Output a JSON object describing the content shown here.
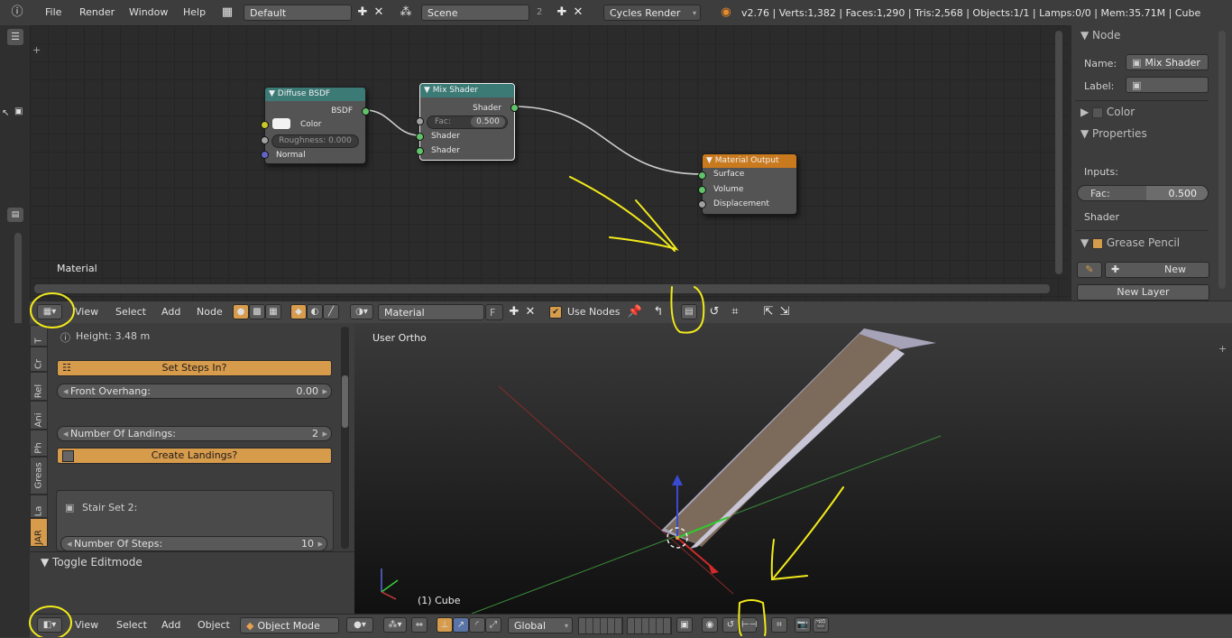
{
  "topbar": {
    "menus": [
      "File",
      "Render",
      "Window",
      "Help"
    ],
    "layout_value": "Default",
    "scene_value": "Scene",
    "scene_users": "2",
    "render_engine": "Cycles Render",
    "stats": "v2.76 | Verts:1,382 | Faces:1,290 | Tris:2,568 | Objects:1/1 | Lamps:0/0 | Mem:35.71M | Cube"
  },
  "node_editor": {
    "context_label": "Material",
    "nodes": {
      "diffuse": {
        "title": "Diffuse BSDF",
        "output": "BSDF",
        "color_label": "Color",
        "roughness": "Roughness: 0.000",
        "normal": "Normal"
      },
      "mix": {
        "title": "Mix Shader",
        "output": "Shader",
        "fac_label": "Fac:",
        "fac_value": "0.500",
        "shader1": "Shader",
        "shader2": "Shader"
      },
      "output": {
        "title": "Material Output",
        "surface": "Surface",
        "volume": "Volume",
        "displacement": "Displacement"
      }
    },
    "colors": {
      "diffuse_header": "#3c7a76",
      "mix_header": "#3c7a76",
      "output_header": "#c97a1e",
      "shader_socket": "#61c26a",
      "color_socket": "#c7c729",
      "vector_socket": "#6363c7",
      "grey_socket": "#a1a1a1"
    }
  },
  "right_panel": {
    "node_section": "Node",
    "name_label": "Name:",
    "name_value": "Mix Shader",
    "label_label": "Label:",
    "color_section": "Color",
    "properties_section": "Properties",
    "inputs_label": "Inputs:",
    "fac_label": "Fac:",
    "fac_value": "0.500",
    "shader_label": "Shader",
    "grease_section": "Grease Pencil",
    "new_button": "New",
    "new_layer_button": "New Layer"
  },
  "node_header": {
    "menus": [
      "View",
      "Select",
      "Add",
      "Node"
    ],
    "material_value": "Material",
    "fake_user": "F",
    "use_nodes_label": "Use Nodes"
  },
  "toolshelf": {
    "tabs": [
      "T",
      "Cr",
      "Rel",
      "Ani",
      "Ph",
      "Greas",
      "La",
      "JAR"
    ],
    "height_text": "Height: 3.48 m",
    "set_steps_button": "Set Steps In?",
    "front_overhang_label": "Front Overhang:",
    "front_overhang_value": "0.00",
    "landings_label": "Number Of Landings:",
    "landings_value": "2",
    "create_landings_button": "Create Landings?",
    "stair_set_label": "Stair Set 2:",
    "steps_label": "Number Of Steps:",
    "steps_value": "10",
    "toggle_editmode": "Toggle Editmode"
  },
  "viewport": {
    "view_label": "User Ortho",
    "object_label": "(1) Cube"
  },
  "bottom_bar": {
    "menus": [
      "View",
      "Select",
      "Add",
      "Object"
    ],
    "mode_value": "Object Mode",
    "orientation_value": "Global"
  },
  "annotation_color": "#f2ea1b"
}
